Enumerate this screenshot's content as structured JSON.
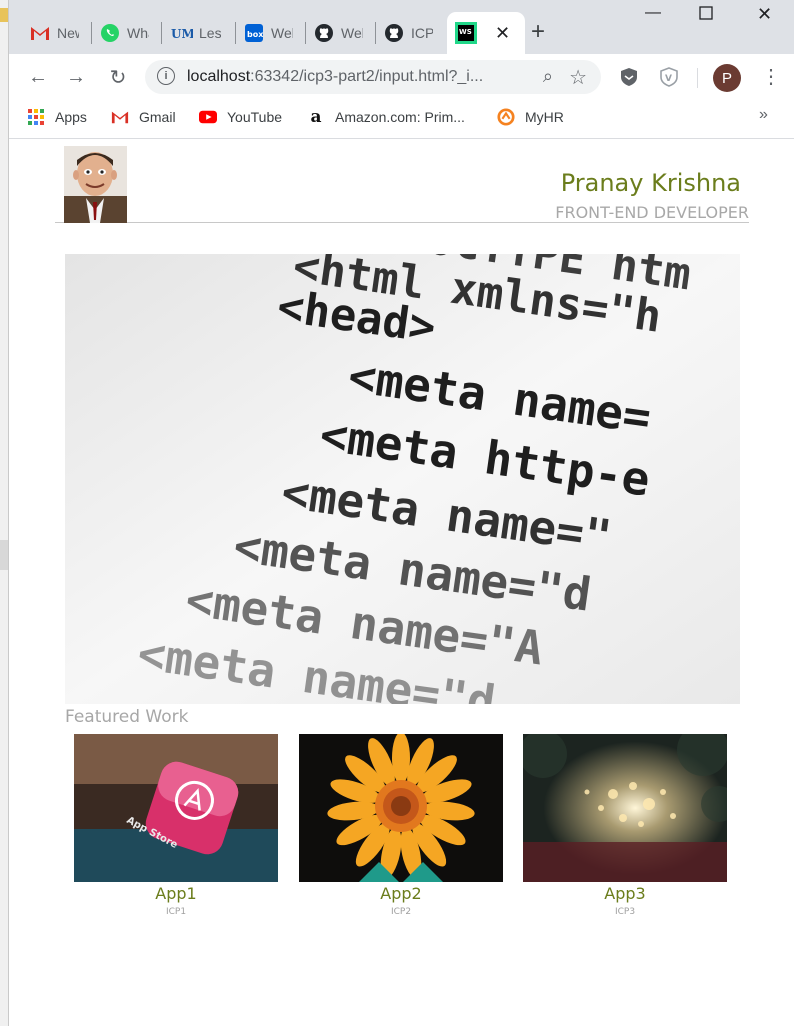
{
  "browser": {
    "tabs": [
      {
        "label": "New",
        "icon": "gmail-icon"
      },
      {
        "label": "WhatsApp",
        "icon": "whatsapp-icon"
      },
      {
        "label": "Lesson",
        "icon": "umkc-icon"
      },
      {
        "label": "Welcome",
        "icon": "box-icon"
      },
      {
        "label": "Web",
        "icon": "github-icon"
      },
      {
        "label": "ICP",
        "icon": "github-icon"
      }
    ],
    "active_tab": {
      "label": "WS",
      "icon": "webstorm-icon"
    },
    "url_host": "localhost",
    "url_path": ":63342/icp3-part2/input.html?_i...",
    "profile_initial": "P",
    "bookmarks": [
      {
        "label": "Apps",
        "icon": "apps-grid-icon"
      },
      {
        "label": "Gmail",
        "icon": "gmail-icon"
      },
      {
        "label": "YouTube",
        "icon": "youtube-icon"
      },
      {
        "label": "Amazon.com: Prim...",
        "icon": "amazon-icon"
      },
      {
        "label": "MyHR",
        "icon": "myhr-icon"
      }
    ],
    "more_bookmarks": "»"
  },
  "page": {
    "name": "Pranay Krishna",
    "role": "FRONT-END DEVELOPER",
    "featured_title": "Featured Work",
    "hero_code_lines": [
      "<!DOCTYPE htm",
      "<html xmlns=\"h",
      "<head>",
      "<meta name=",
      "<meta http-e",
      "<meta name=\"",
      "<meta name=\"d",
      "<meta name=\"A",
      "<meta name=\"d"
    ],
    "cards": [
      {
        "title": "App1",
        "subtitle": "ICP1"
      },
      {
        "title": "App2",
        "subtitle": "ICP2"
      },
      {
        "title": "App3",
        "subtitle": "ICP3"
      }
    ]
  },
  "colors": {
    "accent_name": "#6b7d1c",
    "muted": "#a8a8a8",
    "tab_strip": "#dee1e6"
  }
}
